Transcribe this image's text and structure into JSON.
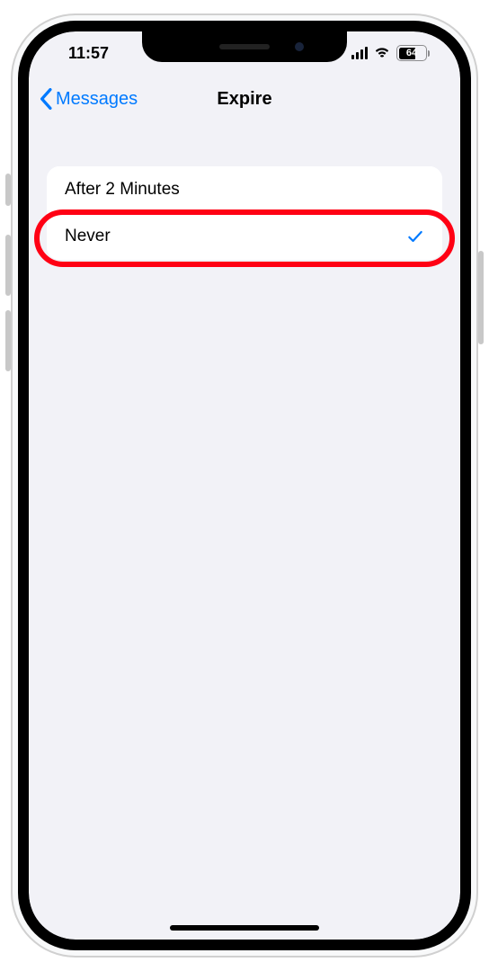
{
  "status": {
    "time": "11:57",
    "battery_level": "64"
  },
  "nav": {
    "back_label": "Messages",
    "title": "Expire"
  },
  "options": [
    {
      "label": "After 2 Minutes",
      "selected": false
    },
    {
      "label": "Never",
      "selected": true
    }
  ],
  "annotation": {
    "highlight_index": 1,
    "color": "#ff0014"
  }
}
